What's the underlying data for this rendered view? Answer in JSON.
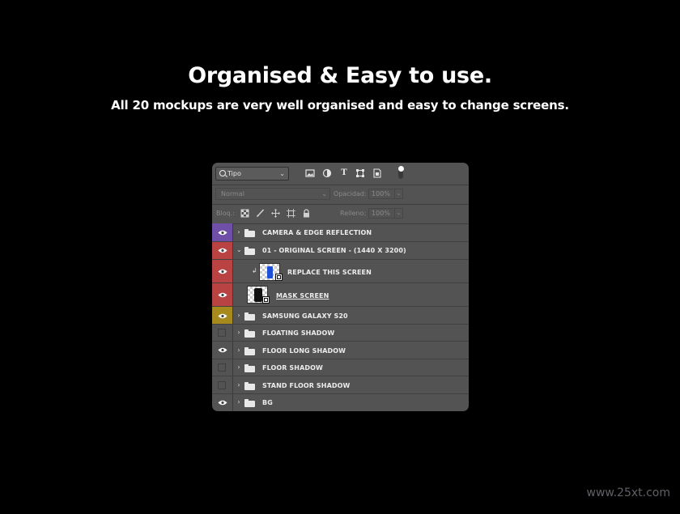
{
  "headline": "Organised & Easy to use.",
  "subheadline": "All 20 mockups are very well organised and easy to change screens.",
  "watermark": "www.25xt.com",
  "panel": {
    "filter": {
      "kind_value": "Tipo",
      "icons": [
        "image-filter-icon",
        "adjustment-filter-icon",
        "type-filter-icon",
        "shape-filter-icon",
        "smart-object-filter-icon"
      ]
    },
    "blend": {
      "mode": "Normal",
      "opacity_label": "Opacidad:",
      "opacity_value": "100%"
    },
    "lock": {
      "label": "Bloq.:",
      "icons": [
        "lock-transparent-icon",
        "lock-image-icon",
        "lock-position-icon",
        "lock-artboard-icon",
        "lock-all-icon"
      ],
      "fill_label": "Relleno:",
      "fill_value": "100%"
    },
    "layers": [
      {
        "name": "CAMERA & EDGE REFLECTION",
        "color": "#6f4fa8",
        "visible": true,
        "type": "group",
        "expanded": false
      },
      {
        "name": "01 - ORIGINAL SCREEN - (1440 X 3200)",
        "color": "#b94242",
        "visible": true,
        "type": "group",
        "expanded": true
      },
      {
        "name": "REPLACE THIS SCREEN",
        "color": "#b94242",
        "visible": true,
        "type": "smart-object",
        "clipped": true
      },
      {
        "name": "MASK SCREEN",
        "color": "#b94242",
        "visible": true,
        "type": "smart-object",
        "underlined": true
      },
      {
        "name": "SAMSUNG GALAXY S20",
        "color": "#a68a1e",
        "visible": true,
        "type": "group",
        "expanded": false
      },
      {
        "name": "FLOATING SHADOW",
        "color": "",
        "visible": false,
        "type": "group",
        "expanded": false
      },
      {
        "name": "FLOOR LONG SHADOW",
        "color": "",
        "visible": true,
        "type": "group",
        "expanded": false
      },
      {
        "name": "FLOOR SHADOW",
        "color": "",
        "visible": false,
        "type": "group",
        "expanded": false
      },
      {
        "name": "STAND FLOOR SHADOW",
        "color": "",
        "visible": false,
        "type": "group",
        "expanded": false
      },
      {
        "name": "BG",
        "color": "",
        "visible": true,
        "type": "group",
        "expanded": false
      }
    ]
  }
}
